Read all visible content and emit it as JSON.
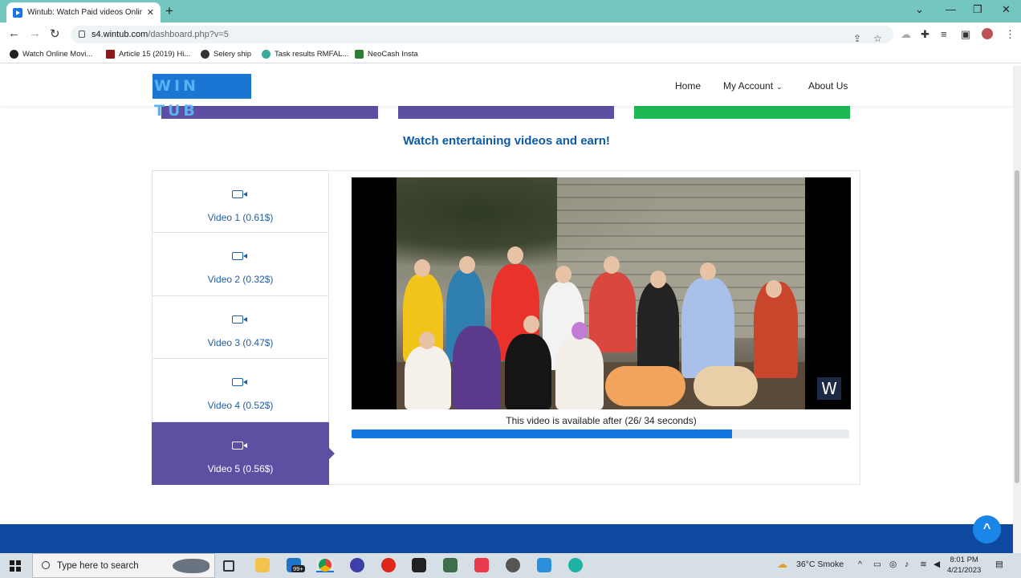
{
  "browser": {
    "tab_title": "Wintub: Watch Paid videos Onlin",
    "tab_close": "✕",
    "new_tab": "+",
    "url_host": "s4.wintub.com",
    "url_path": "/dashboard.php?v=5",
    "window_controls": [
      "⌄",
      "—",
      "❐",
      "✕"
    ]
  },
  "bookmarks": [
    {
      "label": "Watch Online Movi...",
      "color": "#222222"
    },
    {
      "label": "Article 15 (2019) Hi...",
      "color": "#8b1a1a"
    },
    {
      "label": "Selery ship",
      "color": "#333333"
    },
    {
      "label": "Task results RMFAL...",
      "color": "#3aa89a"
    },
    {
      "label": "NeoCash Insta",
      "color": "#2e7d32"
    }
  ],
  "site": {
    "logo_text": "WIN TUB",
    "nav": {
      "home": "Home",
      "account": "My Account",
      "about": "About Us"
    },
    "bar_colors": [
      "#5e4fa2",
      "#5e4fa2",
      "#1db954"
    ],
    "headline": "Watch entertaining videos and earn!",
    "videos": [
      {
        "label": "Video 1 (0.61$)",
        "active": false
      },
      {
        "label": "Video 2 (0.32$)",
        "active": false
      },
      {
        "label": "Video 3 (0.47$)",
        "active": false
      },
      {
        "label": "Video 4 (0.52$)",
        "active": false
      },
      {
        "label": "Video 5 (0.56$)",
        "active": true
      }
    ],
    "player": {
      "watermark": "W",
      "caption": "This video is available after (26/ 34 seconds)",
      "progress_fraction": 0.765
    },
    "scroll_top_icon": "^"
  },
  "taskbar": {
    "search_placeholder": "Type here to search",
    "weather": "36°C  Smoke",
    "time": "8:01 PM",
    "date": "4/21/2023",
    "mail_badge": "99+"
  },
  "colors": {
    "accent_purple": "#5e4fa2",
    "accent_green": "#1db954",
    "link_blue": "#1d5fa8",
    "footer_blue": "#0d4aa0",
    "progress_blue": "#1277e0"
  }
}
